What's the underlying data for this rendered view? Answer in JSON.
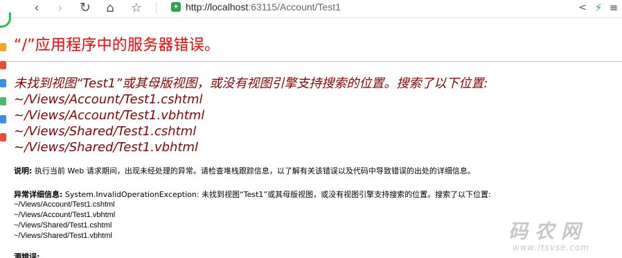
{
  "browser": {
    "url_host": "http://localhost",
    "url_rest": ":63115/Account/Test1",
    "back_icon": "‹",
    "forward_icon": "›",
    "reload_icon": "↻",
    "home_icon": "⌂",
    "star_icon": "☆",
    "secure_icon": "+",
    "share_icon": "<",
    "bolt_icon": "⚡",
    "menu_icon": "≡"
  },
  "page": {
    "title": "“/”应用程序中的服务器错误。",
    "error_heading": "未找到视图“Test1”或其母版视图，或没有视图引擎支持搜索的位置。搜索了以下位置:",
    "searched_paths": [
      "~/Views/Account/Test1.cshtml",
      "~/Views/Account/Test1.vbhtml",
      "~/Views/Shared/Test1.cshtml",
      "~/Views/Shared/Test1.vbhtml"
    ],
    "description_label": "说明:",
    "description_text": " 执行当前 Web 请求期间，出现未经处理的异常。请检查堆栈跟踪信息，以了解有关该错误以及代码中导致错误的出处的详细信息。",
    "exception_label": "异常详细信息:",
    "exception_text": " System.InvalidOperationException: 未找到视图“Test1”或其母版视图，或没有视图引擎支持搜索的位置。搜索了以下位置:",
    "exception_paths": [
      "~/Views/Account/Test1.cshtml",
      "~/Views/Account/Test1.vbhtml",
      "~/Views/Shared/Test1.cshtml",
      "~/Views/Shared/Test1.vbhtml"
    ],
    "source_error_label": "源错误:"
  },
  "watermark": {
    "title": "码农网",
    "url": "www.itsvse.com"
  },
  "colors": {
    "title_red": "#ff0000",
    "error_darkred": "#8b0000",
    "secure_green": "#2ea44f"
  }
}
